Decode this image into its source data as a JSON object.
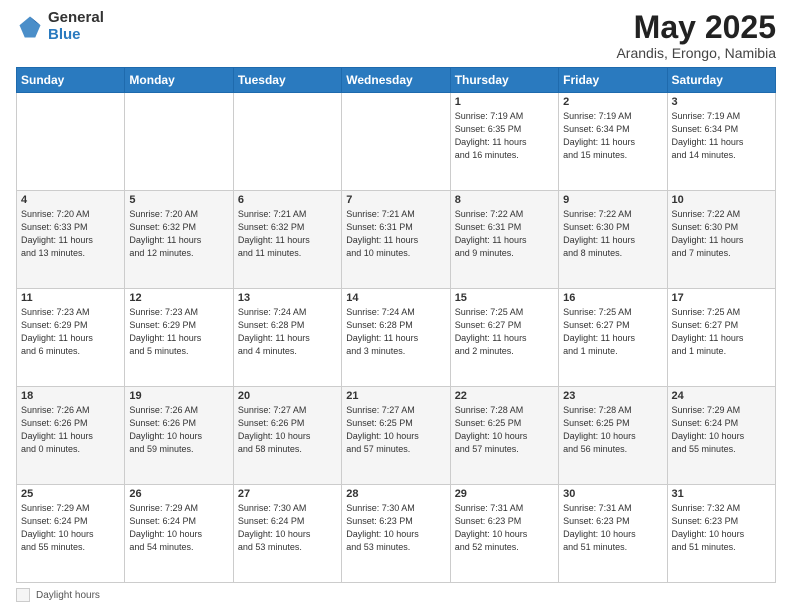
{
  "header": {
    "logo_general": "General",
    "logo_blue": "Blue",
    "title": "May 2025",
    "location": "Arandis, Erongo, Namibia"
  },
  "days_of_week": [
    "Sunday",
    "Monday",
    "Tuesday",
    "Wednesday",
    "Thursday",
    "Friday",
    "Saturday"
  ],
  "footer": {
    "label": "Daylight hours"
  },
  "weeks": [
    [
      {
        "day": "",
        "info": ""
      },
      {
        "day": "",
        "info": ""
      },
      {
        "day": "",
        "info": ""
      },
      {
        "day": "",
        "info": ""
      },
      {
        "day": "1",
        "info": "Sunrise: 7:19 AM\nSunset: 6:35 PM\nDaylight: 11 hours\nand 16 minutes."
      },
      {
        "day": "2",
        "info": "Sunrise: 7:19 AM\nSunset: 6:34 PM\nDaylight: 11 hours\nand 15 minutes."
      },
      {
        "day": "3",
        "info": "Sunrise: 7:19 AM\nSunset: 6:34 PM\nDaylight: 11 hours\nand 14 minutes."
      }
    ],
    [
      {
        "day": "4",
        "info": "Sunrise: 7:20 AM\nSunset: 6:33 PM\nDaylight: 11 hours\nand 13 minutes."
      },
      {
        "day": "5",
        "info": "Sunrise: 7:20 AM\nSunset: 6:32 PM\nDaylight: 11 hours\nand 12 minutes."
      },
      {
        "day": "6",
        "info": "Sunrise: 7:21 AM\nSunset: 6:32 PM\nDaylight: 11 hours\nand 11 minutes."
      },
      {
        "day": "7",
        "info": "Sunrise: 7:21 AM\nSunset: 6:31 PM\nDaylight: 11 hours\nand 10 minutes."
      },
      {
        "day": "8",
        "info": "Sunrise: 7:22 AM\nSunset: 6:31 PM\nDaylight: 11 hours\nand 9 minutes."
      },
      {
        "day": "9",
        "info": "Sunrise: 7:22 AM\nSunset: 6:30 PM\nDaylight: 11 hours\nand 8 minutes."
      },
      {
        "day": "10",
        "info": "Sunrise: 7:22 AM\nSunset: 6:30 PM\nDaylight: 11 hours\nand 7 minutes."
      }
    ],
    [
      {
        "day": "11",
        "info": "Sunrise: 7:23 AM\nSunset: 6:29 PM\nDaylight: 11 hours\nand 6 minutes."
      },
      {
        "day": "12",
        "info": "Sunrise: 7:23 AM\nSunset: 6:29 PM\nDaylight: 11 hours\nand 5 minutes."
      },
      {
        "day": "13",
        "info": "Sunrise: 7:24 AM\nSunset: 6:28 PM\nDaylight: 11 hours\nand 4 minutes."
      },
      {
        "day": "14",
        "info": "Sunrise: 7:24 AM\nSunset: 6:28 PM\nDaylight: 11 hours\nand 3 minutes."
      },
      {
        "day": "15",
        "info": "Sunrise: 7:25 AM\nSunset: 6:27 PM\nDaylight: 11 hours\nand 2 minutes."
      },
      {
        "day": "16",
        "info": "Sunrise: 7:25 AM\nSunset: 6:27 PM\nDaylight: 11 hours\nand 1 minute."
      },
      {
        "day": "17",
        "info": "Sunrise: 7:25 AM\nSunset: 6:27 PM\nDaylight: 11 hours\nand 1 minute."
      }
    ],
    [
      {
        "day": "18",
        "info": "Sunrise: 7:26 AM\nSunset: 6:26 PM\nDaylight: 11 hours\nand 0 minutes."
      },
      {
        "day": "19",
        "info": "Sunrise: 7:26 AM\nSunset: 6:26 PM\nDaylight: 10 hours\nand 59 minutes."
      },
      {
        "day": "20",
        "info": "Sunrise: 7:27 AM\nSunset: 6:26 PM\nDaylight: 10 hours\nand 58 minutes."
      },
      {
        "day": "21",
        "info": "Sunrise: 7:27 AM\nSunset: 6:25 PM\nDaylight: 10 hours\nand 57 minutes."
      },
      {
        "day": "22",
        "info": "Sunrise: 7:28 AM\nSunset: 6:25 PM\nDaylight: 10 hours\nand 57 minutes."
      },
      {
        "day": "23",
        "info": "Sunrise: 7:28 AM\nSunset: 6:25 PM\nDaylight: 10 hours\nand 56 minutes."
      },
      {
        "day": "24",
        "info": "Sunrise: 7:29 AM\nSunset: 6:24 PM\nDaylight: 10 hours\nand 55 minutes."
      }
    ],
    [
      {
        "day": "25",
        "info": "Sunrise: 7:29 AM\nSunset: 6:24 PM\nDaylight: 10 hours\nand 55 minutes."
      },
      {
        "day": "26",
        "info": "Sunrise: 7:29 AM\nSunset: 6:24 PM\nDaylight: 10 hours\nand 54 minutes."
      },
      {
        "day": "27",
        "info": "Sunrise: 7:30 AM\nSunset: 6:24 PM\nDaylight: 10 hours\nand 53 minutes."
      },
      {
        "day": "28",
        "info": "Sunrise: 7:30 AM\nSunset: 6:23 PM\nDaylight: 10 hours\nand 53 minutes."
      },
      {
        "day": "29",
        "info": "Sunrise: 7:31 AM\nSunset: 6:23 PM\nDaylight: 10 hours\nand 52 minutes."
      },
      {
        "day": "30",
        "info": "Sunrise: 7:31 AM\nSunset: 6:23 PM\nDaylight: 10 hours\nand 51 minutes."
      },
      {
        "day": "31",
        "info": "Sunrise: 7:32 AM\nSunset: 6:23 PM\nDaylight: 10 hours\nand 51 minutes."
      }
    ]
  ]
}
